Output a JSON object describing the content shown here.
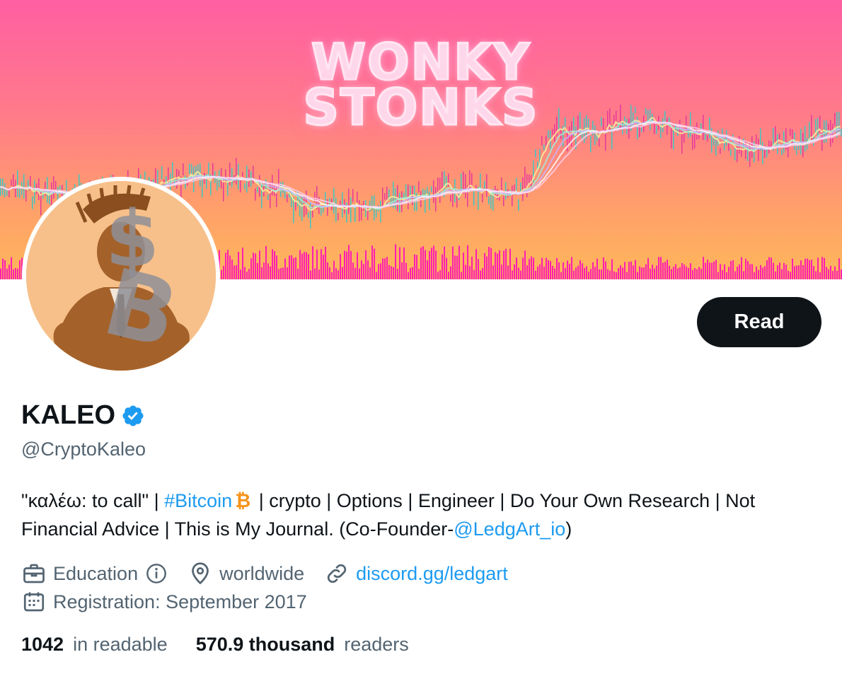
{
  "banner": {
    "title_line1": "WONKY",
    "title_line2": "STONKS",
    "colors": {
      "top": "#ff5fa2",
      "bottom": "#ffb85a",
      "volume": "#ff1fb0",
      "text": "#ffd7ea"
    }
  },
  "avatar": {
    "icon": "spartan-bitcoin-avatar"
  },
  "actions": {
    "read_label": "Read"
  },
  "profile": {
    "display_name": "KALEO",
    "verified_icon": "verified-badge-icon",
    "handle": "@CryptoKaleo",
    "bio": {
      "part1": "\"καλέω: to call\" | ",
      "hashtag": "#Bitcoin",
      "btc_icon": "bitcoin-icon",
      "part2": " | crypto | Options | Engineer | Do Your Own Research | Not Financial Advice | This is My Journal. (Co-Founder-",
      "mention": "@LedgArt_io",
      "part3": ")"
    },
    "meta": {
      "category": "Education",
      "location": "worldwide",
      "website": "discord.gg/ledgart",
      "joined": "Registration: September 2017"
    },
    "stats": {
      "following_count": "1042",
      "following_label": "in readable",
      "followers_count": "570.9 thousand",
      "followers_label": "readers"
    }
  },
  "colors": {
    "accent": "#1d9bf0",
    "text": "#0f1419",
    "secondary": "#536471",
    "button": "#0f1419"
  }
}
